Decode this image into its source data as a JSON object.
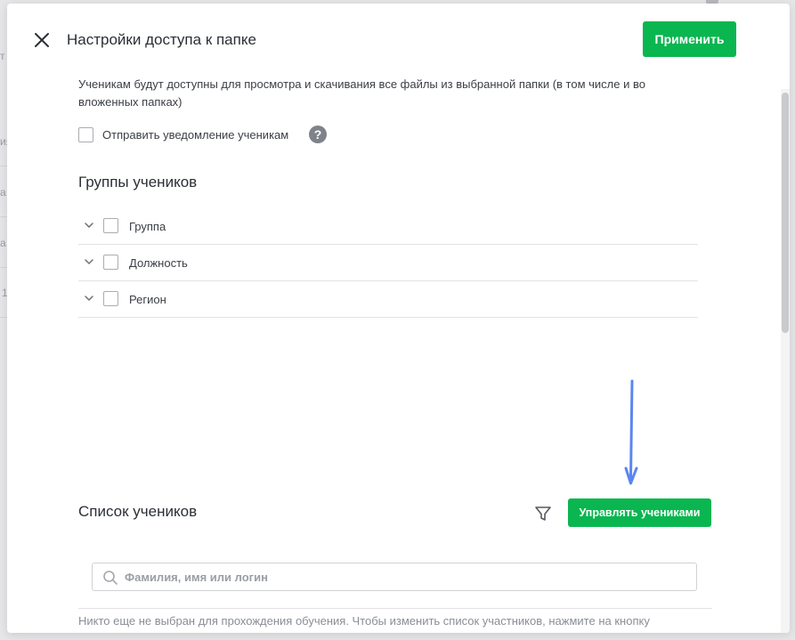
{
  "modal": {
    "title": "Настройки доступа к папке",
    "apply_label": "Применить",
    "description": "Ученикам будут доступны для просмотра и скачивания все файлы из выбранной папки (в том числе и во вложенных папках)",
    "notify_label": "Отправить уведомление ученикам",
    "help_symbol": "?",
    "groups_title": "Группы учеников",
    "groups": [
      {
        "label": "Группа"
      },
      {
        "label": "Должность"
      },
      {
        "label": "Регион"
      }
    ],
    "students_title": "Список учеников",
    "manage_label": "Управлять учениками",
    "search_placeholder": "Фамилия, имя или логин",
    "empty_note": "Никто еще не выбран для прохождения обучения. Чтобы изменить список участников, нажмите на кнопку"
  },
  "background": {
    "fragments": [
      "т",
      "ия",
      "а",
      "а",
      "1"
    ]
  },
  "icons": {
    "close": "close-icon",
    "help": "question-circle-icon",
    "chevron": "chevron-down-icon",
    "filter": "filter-icon",
    "search": "search-icon",
    "arrow": "arrow-down-icon"
  },
  "colors": {
    "accent": "#0ab64f",
    "arrow": "#5b86f0"
  }
}
